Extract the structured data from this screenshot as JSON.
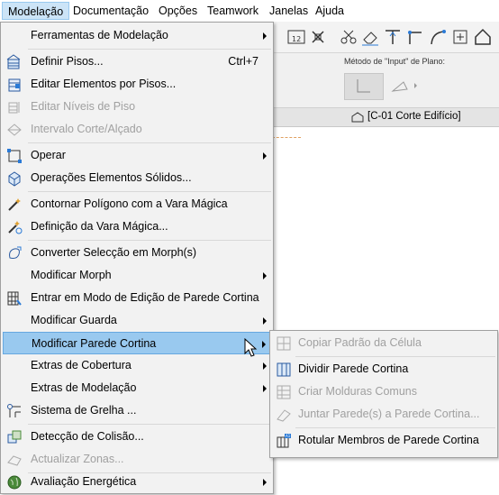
{
  "menubar": {
    "items": [
      {
        "label": "Modelação"
      },
      {
        "label": "Documentação"
      },
      {
        "label": "Opções"
      },
      {
        "label": "Teamwork"
      },
      {
        "label": "Janelas"
      },
      {
        "label": "Ajuda"
      }
    ]
  },
  "background": {
    "plane_method_label": "Método de \"Input\" de Plano:",
    "view_tab_label": "[C-01 Corte Edifício]"
  },
  "menu": {
    "items": [
      {
        "label": "Ferramentas de Modelação",
        "icon": "none",
        "submenu": true
      },
      {
        "label": "Definir Pisos...",
        "shortcut": "Ctrl+7",
        "icon": "stories-icon"
      },
      {
        "label": "Editar Elementos por Pisos...",
        "icon": "edit-stories-icon"
      },
      {
        "label": "Editar Níveis de Piso",
        "icon": "story-levels-icon",
        "disabled": true
      },
      {
        "label": "Intervalo Corte/Alçado",
        "icon": "section-range-icon",
        "disabled": true
      },
      {
        "label": "Operar",
        "icon": "operate-icon",
        "submenu": true
      },
      {
        "label": "Operações Elementos Sólidos...",
        "icon": "solid-ops-icon"
      },
      {
        "label": "Contornar Polígono com a Vara Mágica",
        "icon": "magic-wand-icon"
      },
      {
        "label": "Definição da Vara Mágica...",
        "icon": "magic-wand-settings-icon"
      },
      {
        "label": "Converter Selecção em Morph(s)",
        "icon": "morph-icon"
      },
      {
        "label": "Modificar Morph",
        "icon": "none",
        "submenu": true
      },
      {
        "label": "Entrar em Modo de Edição de Parede Cortina",
        "icon": "curtain-wall-edit-icon"
      },
      {
        "label": "Modificar Guarda",
        "icon": "none",
        "submenu": true
      },
      {
        "label": "Modificar Parede Cortina",
        "icon": "none",
        "submenu": true,
        "highlighted": true
      },
      {
        "label": "Extras de Cobertura",
        "icon": "none",
        "submenu": true
      },
      {
        "label": "Extras de Modelação",
        "icon": "none",
        "submenu": true
      },
      {
        "label": "Sistema de Grelha ...",
        "icon": "grid-system-icon"
      },
      {
        "label": "Detecção de Colisão...",
        "icon": "collision-icon"
      },
      {
        "label": "Actualizar Zonas...",
        "icon": "zones-icon",
        "disabled": true
      },
      {
        "label": "Avaliação Energética",
        "icon": "globe-icon",
        "submenu": true
      }
    ]
  },
  "submenu": {
    "items": [
      {
        "label": "Copiar Padrão da Célula",
        "icon": "copy-pattern-icon",
        "disabled": true
      },
      {
        "label": "Dividir Parede Cortina",
        "icon": "divide-curtain-wall-icon"
      },
      {
        "label": "Criar Molduras Comuns",
        "icon": "common-frames-icon",
        "disabled": true
      },
      {
        "label": "Juntar Parede(s) a Parede Cortina...",
        "icon": "join-walls-icon",
        "disabled": true
      },
      {
        "label": "Rotular Membros de Parede Cortina",
        "icon": "label-members-icon"
      }
    ]
  },
  "colors": {
    "highlight": "#99c9ef",
    "menubar_active": "#cce4f7",
    "disabled_text": "#a0a0a0"
  }
}
